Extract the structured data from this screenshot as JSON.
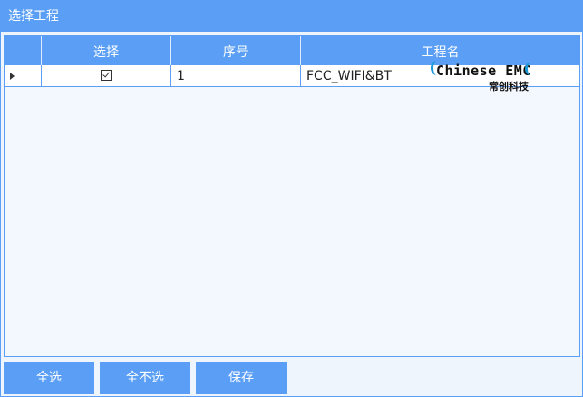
{
  "window": {
    "title": "选择工程"
  },
  "grid": {
    "columns": [
      "",
      "选择",
      "序号",
      "工程名"
    ],
    "rows": [
      {
        "selected": true,
        "index": "1",
        "name": "FCC_WIFI&BT"
      }
    ]
  },
  "watermark": {
    "en": "Chinese EMC",
    "cn": "常创科技"
  },
  "buttons": {
    "select_all": "全选",
    "select_none": "全不选",
    "save": "保存"
  },
  "colors": {
    "accent": "#5a9ff5",
    "background": "#eef5fd",
    "logo_blue": "#1b9ad6"
  }
}
